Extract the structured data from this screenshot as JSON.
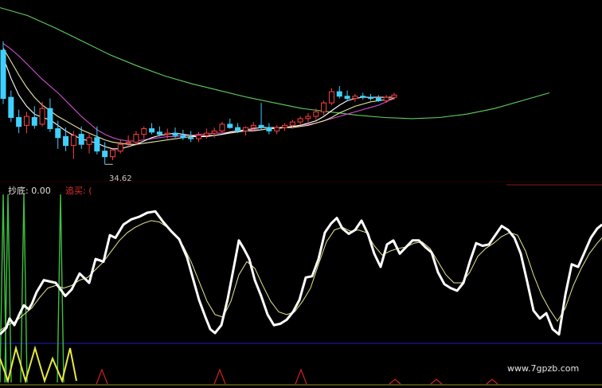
{
  "chart_data": [
    {
      "type": "candlestick",
      "annotations": {
        "low_price": "34.62"
      },
      "colors": {
        "up": "#ff4040",
        "down": "#40d0ff",
        "ma_short": "#ffffff",
        "ma_mid": "#e8e8a0",
        "ma_long": "#d050d0",
        "ma_xlong": "#60d060"
      },
      "ohlc": [
        [
          44.8,
          45.6,
          40.0,
          40.5
        ],
        [
          40.6,
          41.2,
          38.4,
          38.8
        ],
        [
          38.8,
          39.5,
          37.4,
          38.0
        ],
        [
          38.1,
          39.3,
          37.4,
          38.9
        ],
        [
          38.8,
          39.8,
          37.8,
          38.1
        ],
        [
          38.2,
          40.2,
          38.0,
          39.6
        ],
        [
          39.6,
          40.5,
          37.5,
          37.8
        ],
        [
          37.8,
          38.5,
          36.0,
          37.0
        ],
        [
          37.1,
          37.9,
          35.8,
          36.3
        ],
        [
          36.3,
          37.6,
          35.1,
          37.2
        ],
        [
          37.3,
          38.0,
          36.0,
          36.4
        ],
        [
          36.4,
          37.3,
          35.6,
          37.0
        ],
        [
          37.0,
          38.0,
          35.5,
          35.8
        ],
        [
          35.8,
          36.6,
          34.62,
          35.3
        ],
        [
          35.3,
          36.0,
          35.0,
          35.9
        ],
        [
          35.8,
          36.8,
          35.6,
          36.4
        ],
        [
          36.5,
          37.2,
          36.1,
          36.6
        ],
        [
          36.6,
          37.6,
          36.3,
          37.3
        ],
        [
          37.3,
          38.0,
          36.9,
          37.8
        ],
        [
          37.8,
          38.3,
          37.3,
          37.5
        ],
        [
          37.5,
          38.0,
          37.1,
          37.3
        ],
        [
          37.3,
          37.8,
          36.9,
          37.4
        ],
        [
          37.4,
          37.9,
          37.0,
          37.2
        ],
        [
          37.2,
          37.7,
          36.8,
          37.0
        ],
        [
          37.0,
          37.6,
          36.6,
          36.9
        ],
        [
          36.9,
          37.5,
          36.6,
          37.2
        ],
        [
          37.2,
          37.8,
          36.9,
          37.4
        ],
        [
          37.4,
          37.9,
          37.0,
          37.6
        ],
        [
          37.6,
          38.4,
          37.4,
          38.2
        ],
        [
          38.2,
          38.7,
          37.8,
          37.9
        ],
        [
          37.9,
          38.3,
          37.4,
          37.6
        ],
        [
          37.6,
          38.0,
          37.2,
          37.9
        ],
        [
          37.9,
          38.4,
          37.6,
          38.1
        ],
        [
          38.1,
          40.1,
          37.7,
          37.9
        ],
        [
          37.9,
          38.3,
          37.3,
          37.6
        ],
        [
          37.6,
          38.1,
          37.3,
          37.9
        ],
        [
          37.9,
          38.3,
          37.6,
          38.1
        ],
        [
          38.1,
          38.6,
          37.8,
          38.4
        ],
        [
          38.4,
          38.9,
          38.1,
          38.7
        ],
        [
          38.7,
          39.2,
          38.4,
          38.9
        ],
        [
          38.9,
          39.6,
          38.6,
          39.3
        ],
        [
          39.3,
          40.3,
          39.0,
          40.1
        ],
        [
          40.1,
          41.4,
          39.9,
          41.1
        ],
        [
          41.1,
          41.6,
          40.5,
          40.7
        ],
        [
          40.7,
          41.2,
          40.3,
          40.5
        ],
        [
          40.5,
          40.9,
          40.2,
          40.7
        ],
        [
          40.7,
          41.0,
          40.4,
          40.6
        ],
        [
          40.6,
          40.9,
          40.3,
          40.5
        ],
        [
          40.5,
          40.8,
          40.2,
          40.3
        ],
        [
          40.3,
          40.8,
          40.1,
          40.6
        ],
        [
          40.6,
          41.0,
          40.4,
          40.8
        ]
      ],
      "ma_white": [
        44.2,
        42.3,
        40.8,
        39.8,
        39.1,
        38.8,
        38.6,
        38.1,
        37.6,
        37.2,
        36.9,
        36.7,
        36.5,
        36.2,
        36.0,
        36.0,
        36.2,
        36.4,
        36.7,
        37.0,
        37.2,
        37.3,
        37.4,
        37.3,
        37.2,
        37.1,
        37.1,
        37.2,
        37.3,
        37.5,
        37.6,
        37.7,
        37.8,
        37.9,
        37.9,
        37.9,
        37.9,
        38.0,
        38.1,
        38.3,
        38.5,
        38.9,
        39.4,
        39.9,
        40.3,
        40.5,
        40.6,
        40.6,
        40.6,
        40.6,
        40.6
      ],
      "ma_yellow": [
        45.0,
        43.8,
        42.6,
        41.5,
        40.6,
        39.9,
        39.4,
        38.9,
        38.5,
        38.1,
        37.7,
        37.4,
        37.1,
        36.8,
        36.6,
        36.5,
        36.4,
        36.4,
        36.5,
        36.6,
        36.7,
        36.8,
        36.9,
        37.0,
        37.1,
        37.1,
        37.2,
        37.2,
        37.3,
        37.4,
        37.5,
        37.6,
        37.6,
        37.7,
        37.8,
        37.8,
        37.9,
        37.9,
        38.0,
        38.1,
        38.3,
        38.5,
        38.8,
        39.2,
        39.5,
        39.8,
        40.0,
        40.2,
        40.3,
        40.4,
        40.5
      ],
      "ma_magenta": [
        45.4,
        44.9,
        44.3,
        43.6,
        42.9,
        42.2,
        41.6,
        41.0,
        40.3,
        39.6,
        38.9,
        38.3,
        37.7,
        37.3,
        37.0,
        36.8,
        36.7,
        36.7,
        36.8,
        36.9,
        37.0,
        37.1,
        37.1,
        37.2,
        37.2,
        37.3,
        37.3,
        37.4,
        37.4,
        37.5,
        37.6,
        37.6,
        37.7,
        37.7,
        37.8,
        37.9,
        37.9,
        38.0,
        38.1,
        38.2,
        38.3,
        38.5,
        38.7,
        38.9,
        39.1,
        39.3,
        39.5,
        39.7,
        39.9,
        40.2,
        40.5
      ],
      "ma_green": [
        [
          0,
          48.6
        ],
        [
          5,
          47.9
        ],
        [
          10,
          46.8
        ],
        [
          15,
          45.6
        ],
        [
          20,
          44.4
        ],
        [
          25,
          43.4
        ],
        [
          30,
          42.5
        ],
        [
          35,
          41.8
        ],
        [
          40,
          41.2
        ],
        [
          45,
          40.6
        ],
        [
          50,
          40.1
        ],
        [
          55,
          39.6
        ],
        [
          60,
          39.3
        ],
        [
          65,
          39.0
        ],
        [
          70,
          38.8
        ],
        [
          75,
          38.7
        ],
        [
          80,
          38.8
        ],
        [
          85,
          39.1
        ],
        [
          90,
          39.6
        ],
        [
          95,
          40.3
        ],
        [
          100,
          41.0
        ]
      ]
    },
    {
      "type": "line",
      "label_left": "抄底: 0.00",
      "label_right": "追买: (",
      "colors": {
        "k": "#ffffff",
        "d": "#e8e890",
        "signal_green": "#40c040",
        "signal_yellow": "#e8e840",
        "marker": "#d02020",
        "ref_line": "#2020c0"
      },
      "k_line": [
        [
          0,
          5
        ],
        [
          8,
          10
        ],
        [
          12,
          17
        ],
        [
          18,
          12
        ],
        [
          25,
          21
        ],
        [
          30,
          27
        ],
        [
          36,
          24
        ],
        [
          40,
          28
        ],
        [
          46,
          37
        ],
        [
          55,
          46
        ],
        [
          70,
          44
        ],
        [
          82,
          34
        ],
        [
          90,
          39
        ],
        [
          100,
          51
        ],
        [
          112,
          44
        ],
        [
          120,
          62
        ],
        [
          130,
          60
        ],
        [
          138,
          80
        ],
        [
          145,
          78
        ],
        [
          155,
          88
        ],
        [
          165,
          92
        ],
        [
          175,
          94
        ],
        [
          185,
          97
        ],
        [
          195,
          98
        ],
        [
          205,
          90
        ],
        [
          215,
          83
        ],
        [
          225,
          77
        ],
        [
          235,
          63
        ],
        [
          242,
          48
        ],
        [
          250,
          31
        ],
        [
          258,
          18
        ],
        [
          264,
          9
        ],
        [
          270,
          6
        ],
        [
          278,
          12
        ],
        [
          286,
          32
        ],
        [
          294,
          57
        ],
        [
          300,
          76
        ],
        [
          306,
          70
        ],
        [
          313,
          62
        ],
        [
          320,
          46
        ],
        [
          328,
          34
        ],
        [
          336,
          20
        ],
        [
          344,
          12
        ],
        [
          352,
          13
        ],
        [
          360,
          16
        ],
        [
          368,
          22
        ],
        [
          376,
          31
        ],
        [
          384,
          48
        ],
        [
          392,
          49
        ],
        [
          400,
          62
        ],
        [
          408,
          82
        ],
        [
          416,
          89
        ],
        [
          423,
          93
        ],
        [
          430,
          85
        ],
        [
          438,
          81
        ],
        [
          446,
          84
        ],
        [
          454,
          91
        ],
        [
          462,
          81
        ],
        [
          470,
          66
        ],
        [
          478,
          56
        ],
        [
          486,
          73
        ],
        [
          494,
          76
        ],
        [
          502,
          66
        ],
        [
          510,
          71
        ],
        [
          518,
          76
        ],
        [
          526,
          76
        ],
        [
          534,
          71
        ],
        [
          542,
          67
        ],
        [
          550,
          52
        ],
        [
          558,
          43
        ],
        [
          566,
          40
        ],
        [
          574,
          38
        ],
        [
          582,
          44
        ],
        [
          590,
          60
        ],
        [
          598,
          74
        ],
        [
          606,
          72
        ],
        [
          614,
          73
        ],
        [
          622,
          80
        ],
        [
          630,
          87
        ],
        [
          638,
          84
        ],
        [
          646,
          78
        ],
        [
          654,
          66
        ],
        [
          662,
          45
        ],
        [
          670,
          23
        ],
        [
          678,
          17
        ],
        [
          686,
          21
        ],
        [
          694,
          9
        ],
        [
          702,
          5
        ],
        [
          710,
          35
        ],
        [
          718,
          58
        ],
        [
          726,
          56
        ],
        [
          734,
          67
        ],
        [
          742,
          78
        ],
        [
          750,
          85
        ],
        [
          756,
          88
        ]
      ],
      "d_line": [
        [
          0,
          8
        ],
        [
          10,
          12
        ],
        [
          20,
          15
        ],
        [
          30,
          20
        ],
        [
          40,
          25
        ],
        [
          50,
          33
        ],
        [
          60,
          40
        ],
        [
          70,
          42
        ],
        [
          80,
          40
        ],
        [
          90,
          42
        ],
        [
          100,
          46
        ],
        [
          110,
          48
        ],
        [
          120,
          54
        ],
        [
          130,
          60
        ],
        [
          140,
          68
        ],
        [
          150,
          76
        ],
        [
          160,
          82
        ],
        [
          170,
          86
        ],
        [
          180,
          89
        ],
        [
          190,
          91
        ],
        [
          200,
          90
        ],
        [
          210,
          86
        ],
        [
          220,
          80
        ],
        [
          230,
          72
        ],
        [
          240,
          60
        ],
        [
          250,
          45
        ],
        [
          260,
          30
        ],
        [
          270,
          20
        ],
        [
          280,
          18
        ],
        [
          290,
          30
        ],
        [
          300,
          50
        ],
        [
          310,
          60
        ],
        [
          320,
          55
        ],
        [
          330,
          42
        ],
        [
          340,
          30
        ],
        [
          350,
          22
        ],
        [
          360,
          20
        ],
        [
          370,
          22
        ],
        [
          380,
          30
        ],
        [
          390,
          40
        ],
        [
          400,
          58
        ],
        [
          410,
          75
        ],
        [
          420,
          84
        ],
        [
          430,
          86
        ],
        [
          440,
          83
        ],
        [
          450,
          84
        ],
        [
          460,
          82
        ],
        [
          470,
          72
        ],
        [
          480,
          65
        ],
        [
          490,
          68
        ],
        [
          500,
          70
        ],
        [
          510,
          71
        ],
        [
          520,
          74
        ],
        [
          530,
          75
        ],
        [
          540,
          70
        ],
        [
          550,
          60
        ],
        [
          560,
          50
        ],
        [
          570,
          44
        ],
        [
          580,
          44
        ],
        [
          590,
          52
        ],
        [
          600,
          64
        ],
        [
          610,
          70
        ],
        [
          620,
          74
        ],
        [
          630,
          79
        ],
        [
          640,
          82
        ],
        [
          650,
          80
        ],
        [
          660,
          68
        ],
        [
          670,
          50
        ],
        [
          680,
          35
        ],
        [
          690,
          24
        ],
        [
          700,
          15
        ],
        [
          710,
          25
        ],
        [
          720,
          42
        ],
        [
          730,
          55
        ],
        [
          740,
          66
        ],
        [
          750,
          74
        ],
        [
          756,
          78
        ]
      ],
      "y_range": [
        0,
        100
      ]
    }
  ],
  "watermark": "www.7gpzb.com"
}
